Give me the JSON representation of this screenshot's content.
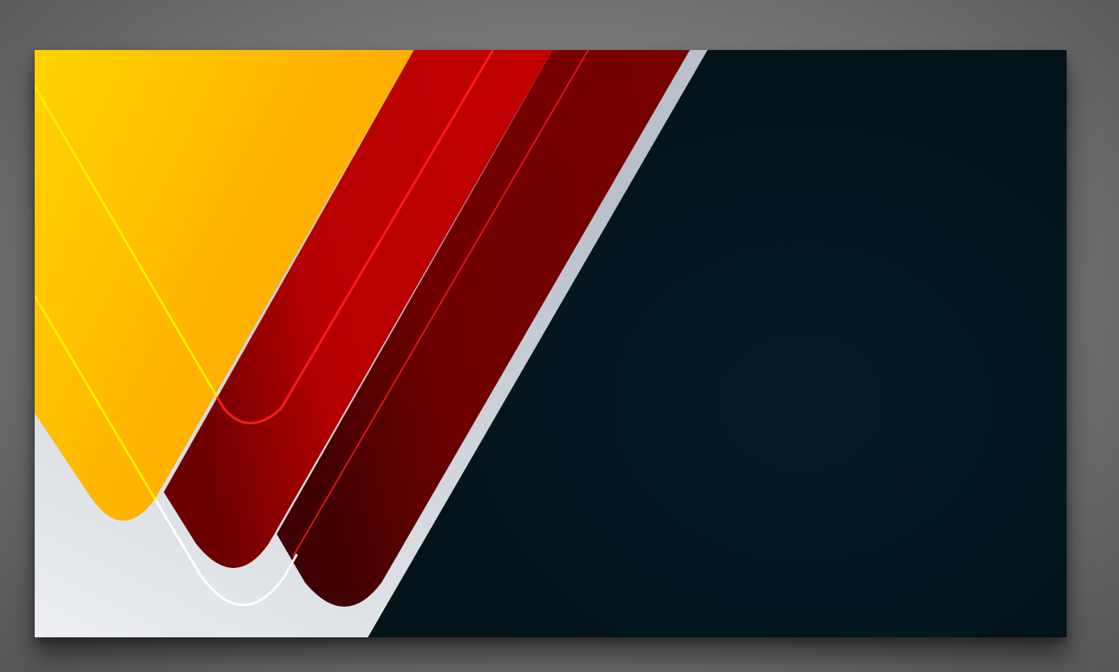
{
  "artwork": {
    "kind": "abstract geometric banner",
    "colors": {
      "background_outer": "#7a7a7a",
      "dark_panel": "#02151c",
      "light_panel": "#c9ced6",
      "yellow": "#ffbf00",
      "red_bright": "#c00000",
      "red_dark": "#730000",
      "line_yellow": "#ffee00",
      "line_red": "#ff1a1a",
      "line_white": "#ffffff"
    }
  }
}
